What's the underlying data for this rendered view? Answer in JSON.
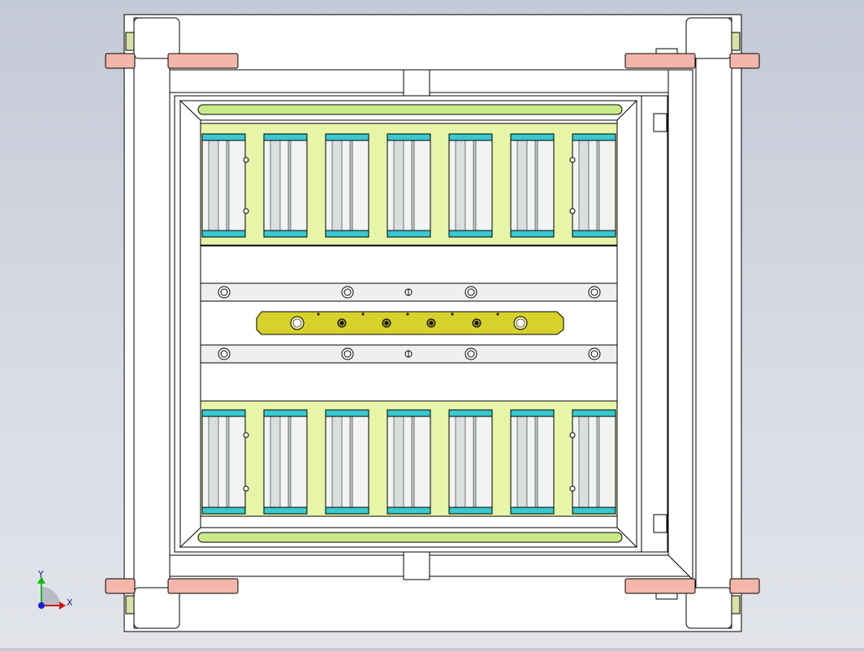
{
  "view": {
    "background_top": "#c4c9d6",
    "background_bottom": "#e2e4ea"
  },
  "colors": {
    "line": "#000000",
    "frame_fill": "#ffffff",
    "pink_tab": "#f4b6aa",
    "tray_fill": "#e6f5a8",
    "rail_green": "#c9ea88",
    "roller_cap": "#39c9d1",
    "roller_body": "#f2f4f4",
    "bar_yellow": "#d7d22a",
    "plate_gray": "#eef0f0"
  },
  "layout": {
    "roller_columns": 7,
    "roller_rows": 2,
    "bar_holes": 6,
    "strip_holes_per_row": 5
  },
  "triad": {
    "x_label": "X",
    "y_label": "Y",
    "x_color": "#d11a1a",
    "y_color": "#17b51c",
    "origin_color": "#1d1dd8"
  },
  "icons": {
    "triad": "coordinate-triad-icon"
  }
}
